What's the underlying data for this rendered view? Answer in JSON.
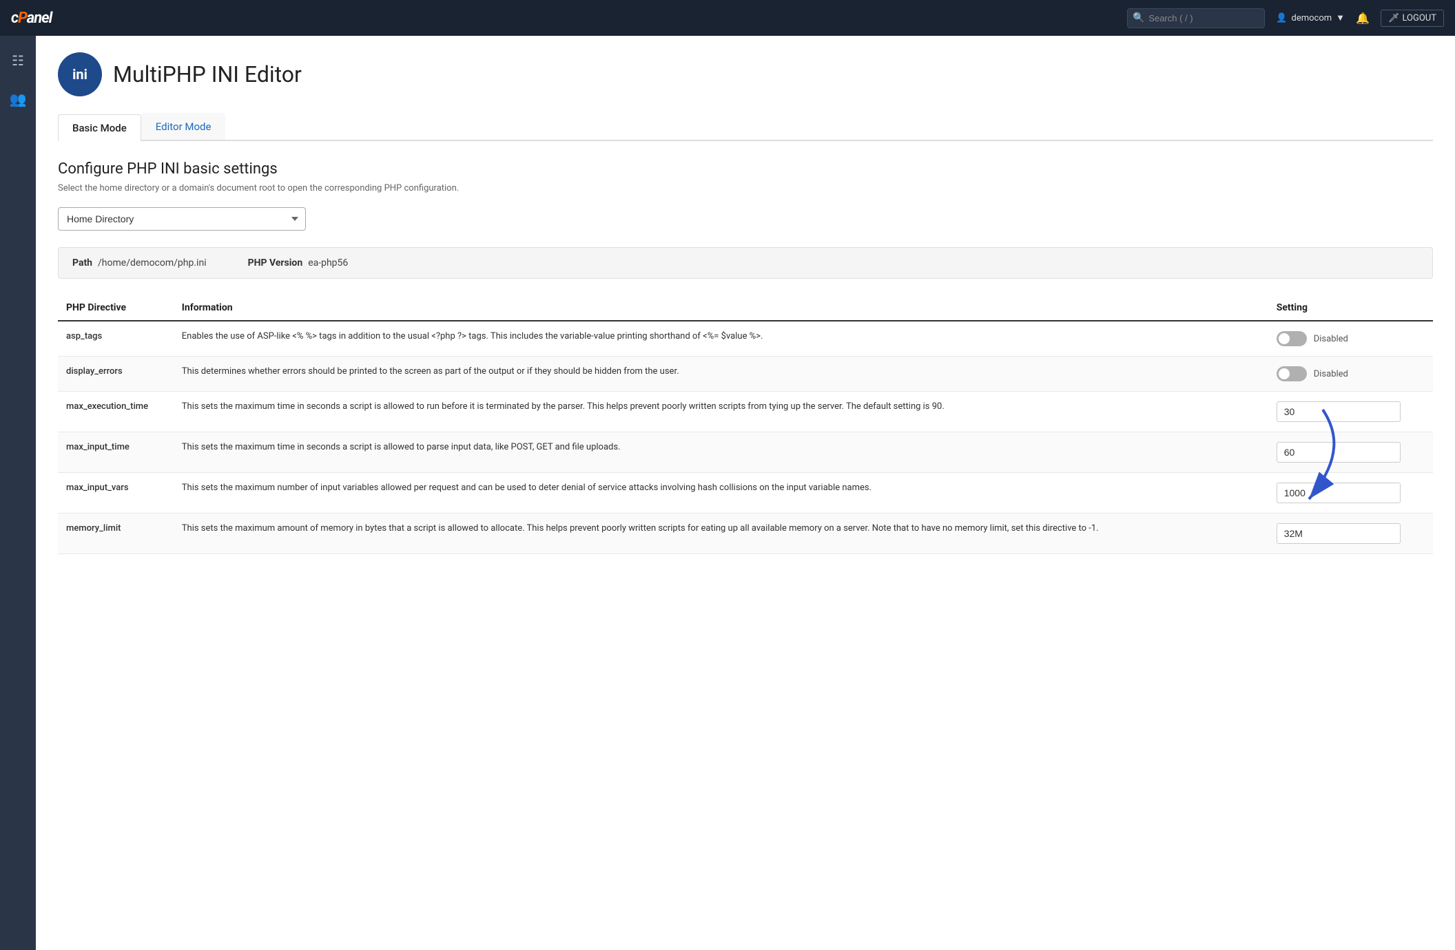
{
  "navbar": {
    "brand": "cPanel",
    "search_placeholder": "Search ( / )",
    "user": "democom",
    "logout_label": "LOGOUT"
  },
  "page": {
    "icon_text": "ini",
    "title": "MultiPHP INI Editor"
  },
  "tabs": [
    {
      "id": "basic",
      "label": "Basic Mode",
      "active": true
    },
    {
      "id": "editor",
      "label": "Editor Mode",
      "active": false
    }
  ],
  "section": {
    "title": "Configure PHP INI basic settings",
    "description": "Select the home directory or a domain's document root to open the corresponding PHP configuration."
  },
  "directory_select": {
    "current_value": "Home Directory",
    "options": [
      "Home Directory"
    ]
  },
  "info_bar": {
    "path_label": "Path",
    "path_value": "/home/democom/php.ini",
    "php_version_label": "PHP Version",
    "php_version_value": "ea-php56"
  },
  "table": {
    "columns": [
      "PHP Directive",
      "Information",
      "Setting"
    ],
    "rows": [
      {
        "directive": "asp_tags",
        "info": "Enables the use of ASP-like <% %> tags in addition to the usual <?php ?> tags. This includes the variable-value printing shorthand of <%= $value %>.",
        "setting_type": "toggle",
        "setting_value": "Disabled",
        "toggle_state": "off"
      },
      {
        "directive": "display_errors",
        "info": "This determines whether errors should be printed to the screen as part of the output or if they should be hidden from the user.",
        "setting_type": "toggle",
        "setting_value": "Disabled",
        "toggle_state": "off"
      },
      {
        "directive": "max_execution_time",
        "info": "This sets the maximum time in seconds a script is allowed to run before it is terminated by the parser. This helps prevent poorly written scripts from tying up the server. The default setting is 90.",
        "setting_type": "number",
        "setting_value": "30"
      },
      {
        "directive": "max_input_time",
        "info": "This sets the maximum time in seconds a script is allowed to parse input data, like POST, GET and file uploads.",
        "setting_type": "number",
        "setting_value": "60"
      },
      {
        "directive": "max_input_vars",
        "info": "This sets the maximum number of input variables allowed per request and can be used to deter denial of service attacks involving hash collisions on the input variable names.",
        "setting_type": "number",
        "setting_value": "1000"
      },
      {
        "directive": "memory_limit",
        "info": "This sets the maximum amount of memory in bytes that a script is allowed to allocate. This helps prevent poorly written scripts for eating up all available memory on a server. Note that to have no memory limit, set this directive to -1.",
        "setting_type": "number",
        "setting_value": "32M"
      }
    ]
  }
}
